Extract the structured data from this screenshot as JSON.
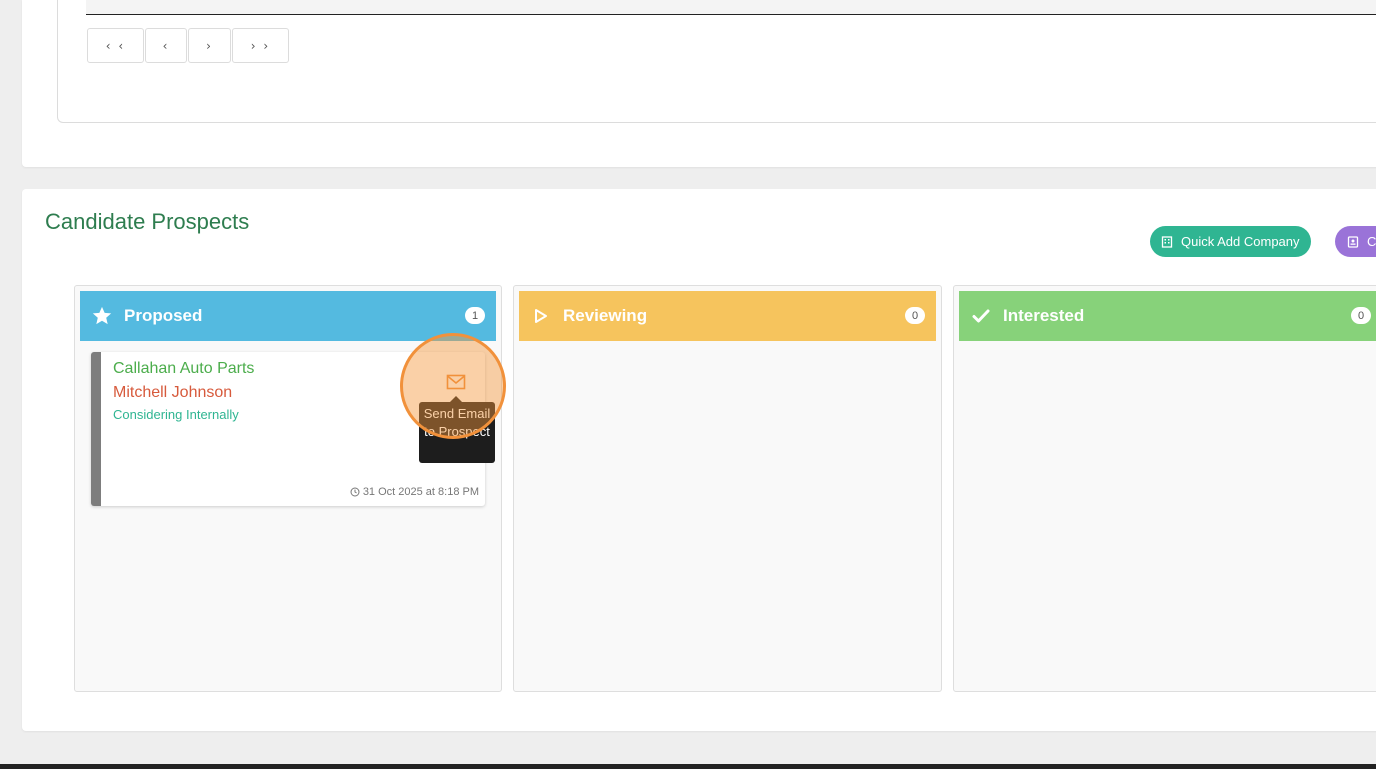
{
  "pagination": {
    "first": "‹ ‹",
    "prev": "‹",
    "next": "›",
    "last": "› ›"
  },
  "prospects": {
    "title": "Candidate Prospects",
    "quick_add_label": "Quick Add Company",
    "second_button_label": "C",
    "columns": [
      {
        "label": "Proposed",
        "count": "1",
        "icon": "star-icon",
        "color": "#54bae0"
      },
      {
        "label": "Reviewing",
        "count": "0",
        "icon": "play-icon",
        "color": "#f6c45d"
      },
      {
        "label": "Interested",
        "count": "0",
        "icon": "check-icon",
        "color": "#87d27a"
      }
    ],
    "card": {
      "company": "Callahan Auto Parts",
      "contact": "Mitchell Johnson",
      "status": "Considering Internally",
      "timestamp": "31 Oct 2025 at 8:18 PM",
      "email_tooltip": "Send Email to Prospect"
    }
  }
}
